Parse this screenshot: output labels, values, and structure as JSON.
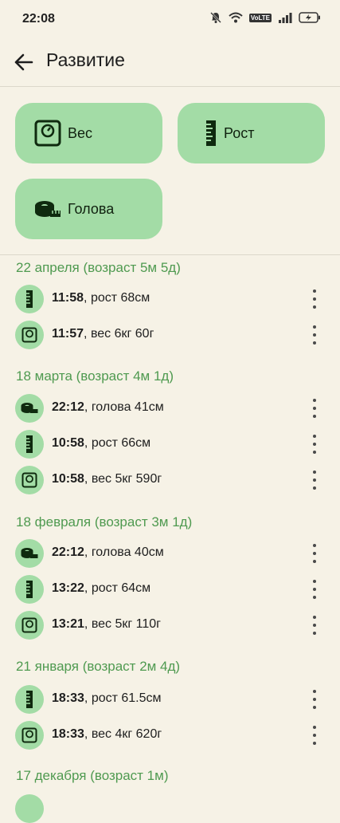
{
  "status_bar": {
    "time": "22:08",
    "volte": "VoLTE"
  },
  "app_bar": {
    "title": "Развитие"
  },
  "buttons": {
    "weight": "Вес",
    "height": "Рост",
    "head": "Голова"
  },
  "groups": [
    {
      "header": "22 апреля (возраст 5м 5д)",
      "entries": [
        {
          "type": "height",
          "time": "11:58",
          "text": ", рост 68см"
        },
        {
          "type": "weight",
          "time": "11:57",
          "text": ", вес 6кг 60г"
        }
      ]
    },
    {
      "header": "18 марта (возраст 4м 1д)",
      "entries": [
        {
          "type": "head",
          "time": "22:12",
          "text": ", голова 41см"
        },
        {
          "type": "height",
          "time": "10:58",
          "text": ", рост 66см"
        },
        {
          "type": "weight",
          "time": "10:58",
          "text": ", вес 5кг 590г"
        }
      ]
    },
    {
      "header": "18 февраля (возраст 3м 1д)",
      "entries": [
        {
          "type": "head",
          "time": "22:12",
          "text": ", голова 40см"
        },
        {
          "type": "height",
          "time": "13:22",
          "text": ", рост 64см"
        },
        {
          "type": "weight",
          "time": "13:21",
          "text": ", вес 5кг 110г"
        }
      ]
    },
    {
      "header": "21 января (возраст 2м 4д)",
      "entries": [
        {
          "type": "height",
          "time": "18:33",
          "text": ", рост 61.5см"
        },
        {
          "type": "weight",
          "time": "18:33",
          "text": ", вес 4кг 620г"
        }
      ]
    },
    {
      "header": "17 декабря (возраст 1м)",
      "entries": []
    }
  ],
  "colors": {
    "background": "#f6f2e6",
    "accent": "#a3dca6",
    "header_text": "#4f9a50"
  }
}
